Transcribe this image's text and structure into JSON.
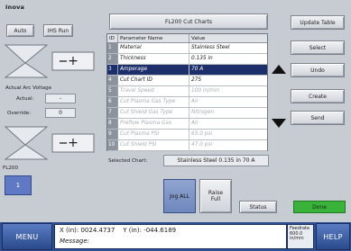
{
  "brand": "Inova",
  "header": {
    "title": "FL200 Cut Charts"
  },
  "left": {
    "auto_label": "Auto",
    "ihs_run_label": "IHS Run",
    "arc_voltage_title": "Actual Arc Voltage",
    "actual_label": "Actual:",
    "actual_value": "-",
    "override_label": "Override:",
    "override_value": "0",
    "station_label": "FL200",
    "station_button_value": "1"
  },
  "table": {
    "columns": [
      "ID",
      "Parameter Name",
      "Value"
    ],
    "rows": [
      {
        "id": "1",
        "name": "Material",
        "value": "Stainless Steel",
        "state": "normal"
      },
      {
        "id": "2",
        "name": "Thickness",
        "value": "0.135 in",
        "state": "normal"
      },
      {
        "id": "3",
        "name": "Amperage",
        "value": "70 A",
        "state": "selected"
      },
      {
        "id": "4",
        "name": "Cut Chart ID",
        "value": "275",
        "state": "normal"
      },
      {
        "id": "5",
        "name": "Travel Speed",
        "value": "100 in/min",
        "state": "dim"
      },
      {
        "id": "6",
        "name": "Cut Plasma Gas Type",
        "value": "Air",
        "state": "dim"
      },
      {
        "id": "7",
        "name": "Cut Shield Gas Type",
        "value": "Nitrogen",
        "state": "dim"
      },
      {
        "id": "8",
        "name": "Preflow Plasma Gas",
        "value": "Air",
        "state": "dim"
      },
      {
        "id": "9",
        "name": "Cut Plasma PSI",
        "value": "65.0 psi",
        "state": "dim"
      },
      {
        "id": "10",
        "name": "Cut Shield PSI",
        "value": "47.0 psi",
        "state": "dim"
      }
    ]
  },
  "selected_chart": {
    "label": "Selected Chart:",
    "value": "Stainless Steel 0.135 in 70 A"
  },
  "right_buttons": {
    "update_table": "Update Table",
    "select": "Select",
    "undo": "Undo",
    "create": "Create",
    "send": "Send"
  },
  "bottom_controls": {
    "jog_all": "Jog ALL",
    "raise_full": "Raise Full",
    "status": "Status",
    "done": "Done"
  },
  "statusbar": {
    "menu_label": "MENU",
    "help_label": "HELP",
    "x_label": "X (in):",
    "x_value": "0024.4737",
    "y_label": "Y (in):",
    "y_value": "-044.6189",
    "message_label": "Message:",
    "feedrate_label": "Feedrate",
    "feedrate_value": "600.0",
    "feedrate_unit": "in/min"
  },
  "colors": {
    "selection": "#1c2f6b",
    "done_green": "#39b33a",
    "status_blue": "#2f4f93",
    "station_button": "#5f79c4"
  }
}
